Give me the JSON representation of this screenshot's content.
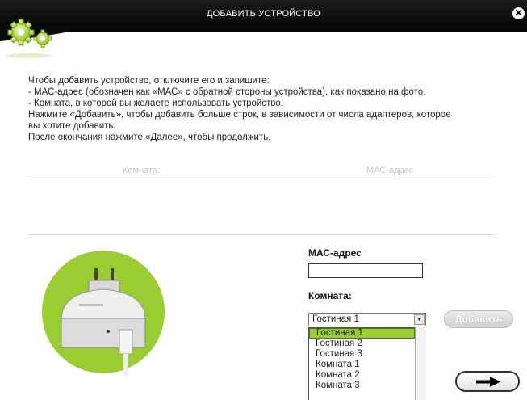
{
  "window": {
    "title": "ДОБАВИТЬ УСТРОЙСТВО",
    "close_icon": "close-icon"
  },
  "instructions": [
    "Чтобы добавить устройство, отключите его и запишите:",
    "- МАС-адрес (обозначен как «МАС» с обратной стороны устройства), как показано на фото.",
    "- Комната, в которой вы желаете использовать устройство.",
    "Нажмите «Добавить», чтобы добавить больше строк, в зависимости от числа адаптеров, которое",
    "вы хотите добавить.",
    "После окончания нажмите «Далее», чтобы продолжить."
  ],
  "table": {
    "columns": [
      "Комната:",
      "МАС-адрес"
    ],
    "rows": []
  },
  "form": {
    "mac_label": "МАС-адрес",
    "mac_value": "",
    "room_label": "Комната:",
    "room_selected": "Гостиная 1",
    "room_options": [
      "Гостиная 1",
      "Гостиная 2",
      "Гостиная 3",
      "Комната:1",
      "Комната:2",
      "Комната:3"
    ],
    "highlighted_option": "Гостиная 1",
    "add_button": "Добавить",
    "next_icon": "arrow-right-icon"
  },
  "colors": {
    "accent_green": "#9acd32",
    "titlebar": "#000000",
    "header_text": "#c8c8c8"
  }
}
